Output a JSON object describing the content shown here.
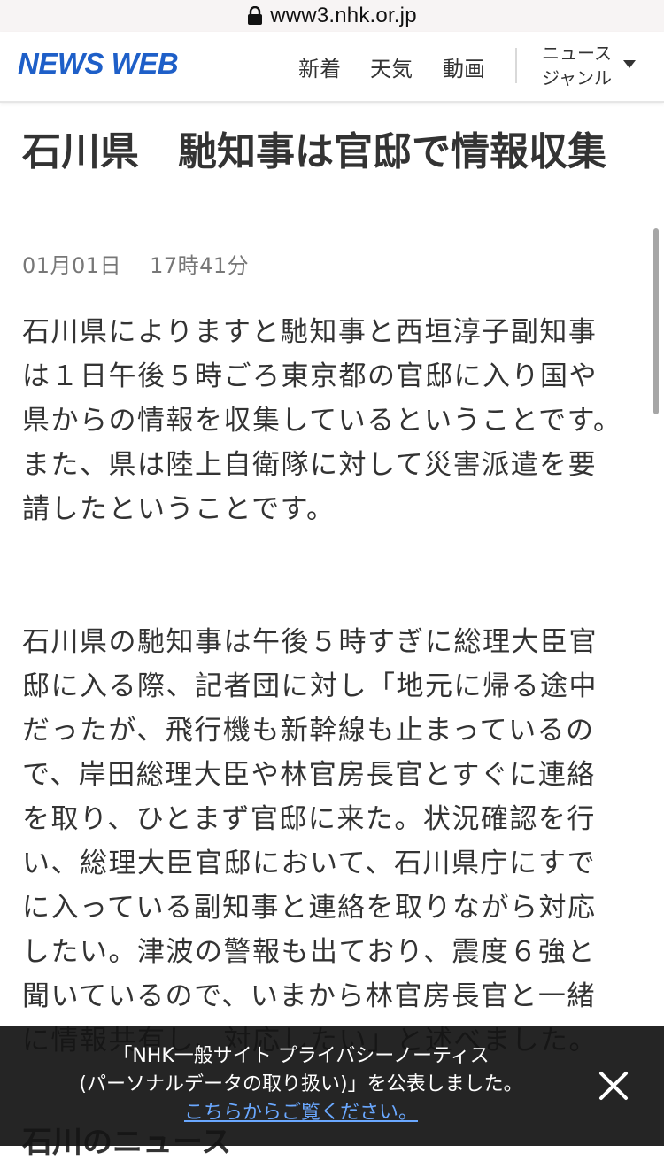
{
  "browser": {
    "url": "www3.nhk.or.jp"
  },
  "header": {
    "logo": "NEWS WEB",
    "nav": {
      "new": "新着",
      "weather": "天気",
      "video": "動画",
      "genre_line1": "ニュース",
      "genre_line2": "ジャンル"
    }
  },
  "article": {
    "title": "石川県　馳知事は官邸で情報収集",
    "date": "01月01日",
    "time": "17時41分",
    "paragraphs": [
      "石川県によりますと馳知事と西垣淳子副知事は１日午後５時ごろ東京都の官邸に入り国や県からの情報を収集しているということです。",
      "また、県は陸上自衛隊に対して災害派遣を要請したということです。",
      "石川県の馳知事は午後５時すぎに総理大臣官邸に入る際、記者団に対し「地元に帰る途中だったが、飛行機も新幹線も止まっているので、岸田総理大臣や林官房長官とすぐに連絡を取り、ひとまず官邸に来た。状況確認を行い、総理大臣官邸において、石川県庁にすでに入っている副知事と連絡を取りながら対応したい。津波の警報も出ており、震度６強と聞いているので、いまから林官房長官と一緒に情報共有し、対応したい」と述べました。"
    ],
    "next_section": "石川のニュース"
  },
  "notice": {
    "line1": "「NHK一般サイト プライバシーノーティス",
    "line2": "(パーソナルデータの取り扱い)」を公表しました。",
    "link": "こちらからご覧ください。"
  },
  "colors": {
    "brand": "#1e5fc8",
    "text": "#333333",
    "muted": "#777777",
    "banner_bg": "#141414",
    "link": "#6aa8ff"
  },
  "icons": {
    "lock": "lock-icon",
    "caret": "chevron-down-icon",
    "close": "close-icon"
  }
}
